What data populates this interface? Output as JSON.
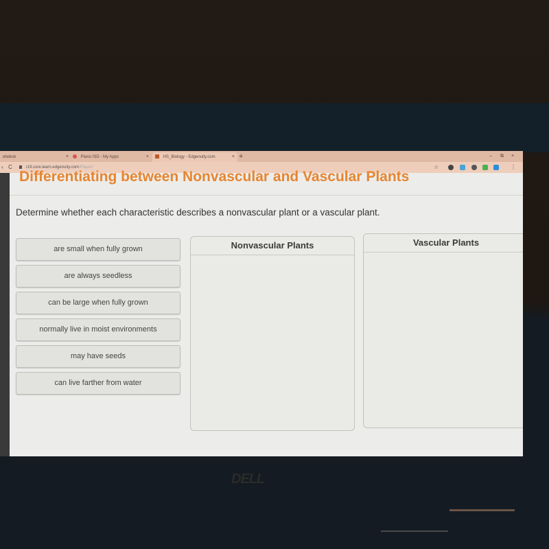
{
  "browser": {
    "tabs": [
      {
        "label": "ebdesk",
        "active": false
      },
      {
        "label": "Plano ISD - My Apps",
        "active": false
      },
      {
        "label": "HS_Biology - Edgenuity.com",
        "active": true
      }
    ],
    "new_tab_label": "+",
    "close_glyph": "×",
    "window_controls": {
      "minimize": "–",
      "restore": "⧉",
      "close": "×"
    },
    "nav": {
      "back": "‹",
      "reload": "C"
    },
    "url": {
      "host": "r19.core.learn.edgenuity.com",
      "path": "/Player/"
    },
    "star": "☆",
    "menu": "⋮",
    "extension_colors": [
      "#444444",
      "#4aa3d8",
      "#555555",
      "#4caf50",
      "#2a8fd8"
    ]
  },
  "page": {
    "title": "Differentiating between Nonvascular and Vascular Plants",
    "title_color": "#e7852f",
    "instructions": "Determine whether each characteristic describes a nonvascular plant or a vascular plant.",
    "characteristics": [
      "are small when fully grown",
      "are always seedless",
      "can be large when fully grown",
      "normally live in moist environments",
      "may have seeds",
      "can live farther from water"
    ],
    "bins": [
      {
        "label": "Nonvascular Plants",
        "items": []
      },
      {
        "label": "Vascular Plants",
        "items": []
      }
    ]
  },
  "device": {
    "brand": "DELL"
  }
}
